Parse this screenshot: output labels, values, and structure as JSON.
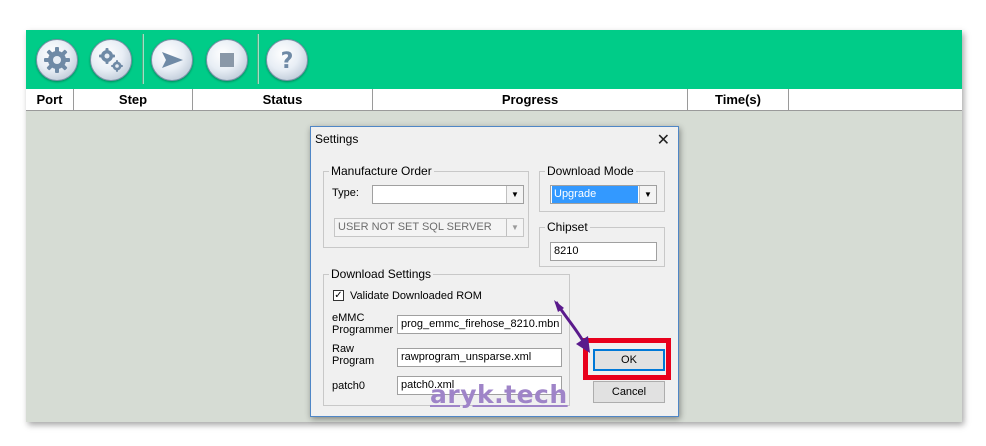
{
  "toolbar": {
    "buttons": [
      {
        "icon": "gear-icon"
      },
      {
        "icon": "gears-icon"
      },
      {
        "icon": "send-icon"
      },
      {
        "icon": "stop-icon"
      },
      {
        "icon": "help-icon"
      }
    ],
    "accent_color": "#00cc88"
  },
  "columns": [
    "Port",
    "Step",
    "Status",
    "Progress",
    "Time(s)"
  ],
  "dialog": {
    "title": "Settings",
    "close_glyph": "✕",
    "manufacture_order": {
      "title": "Manufacture Order",
      "type_label": "Type:",
      "type_value": "",
      "sql_value": "USER NOT SET SQL SERVER"
    },
    "download_mode": {
      "title": "Download Mode",
      "value": "Upgrade"
    },
    "chipset": {
      "title": "Chipset",
      "value": "8210"
    },
    "download_settings": {
      "title": "Download Settings",
      "validate_label": "Validate Downloaded ROM",
      "validate_checked": true,
      "emmc_label_1": "eMMC",
      "emmc_label_2": "Programmer",
      "emmc_value": "prog_emmc_firehose_8210.mbn",
      "raw_label_1": "Raw",
      "raw_label_2": "Program",
      "raw_value": "rawprogram_unsparse.xml",
      "patch_label": "patch0",
      "patch_value": "patch0.xml"
    },
    "ok_label": "OK",
    "cancel_label": "Cancel"
  },
  "highlight_color": "#e8001c",
  "arrow_color": "#5a1a8c",
  "watermark": "aryk.tech"
}
